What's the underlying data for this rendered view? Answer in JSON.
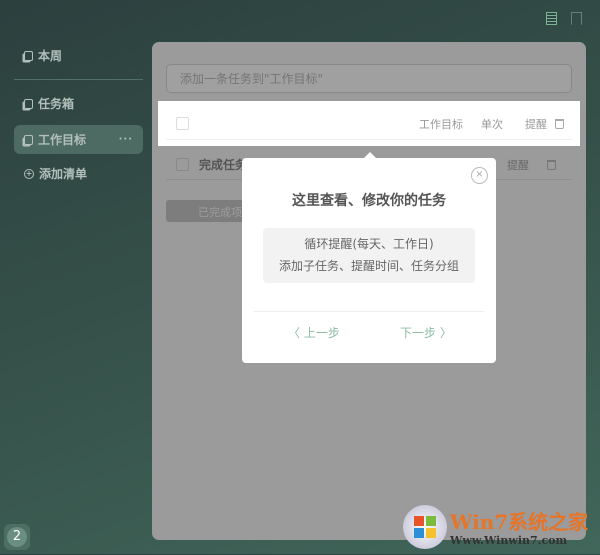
{
  "sidebar": {
    "week": "本周",
    "inbox": "任务箱",
    "active_list": "工作目标",
    "more": "···",
    "add_list": "添加清单"
  },
  "main": {
    "add_placeholder": "添加一条任务到\"工作目标\"",
    "highlight_row": {
      "list": "工作目标",
      "repeat": "单次",
      "remind": "提醒"
    },
    "row2": {
      "title": "完成任务",
      "remind": "提醒"
    },
    "completed_button": "已完成项"
  },
  "dialog": {
    "title": "这里查看、修改你的任务",
    "line1": "循环提醒(每天、工作日)",
    "line2": "添加子任务、提醒时间、任务分组",
    "prev": "〈 上一步",
    "next": "下一步 〉",
    "close": "×"
  },
  "badge": "2",
  "watermark": {
    "brand": "Win7系统之家",
    "url": "Www.Winwin7.com"
  }
}
